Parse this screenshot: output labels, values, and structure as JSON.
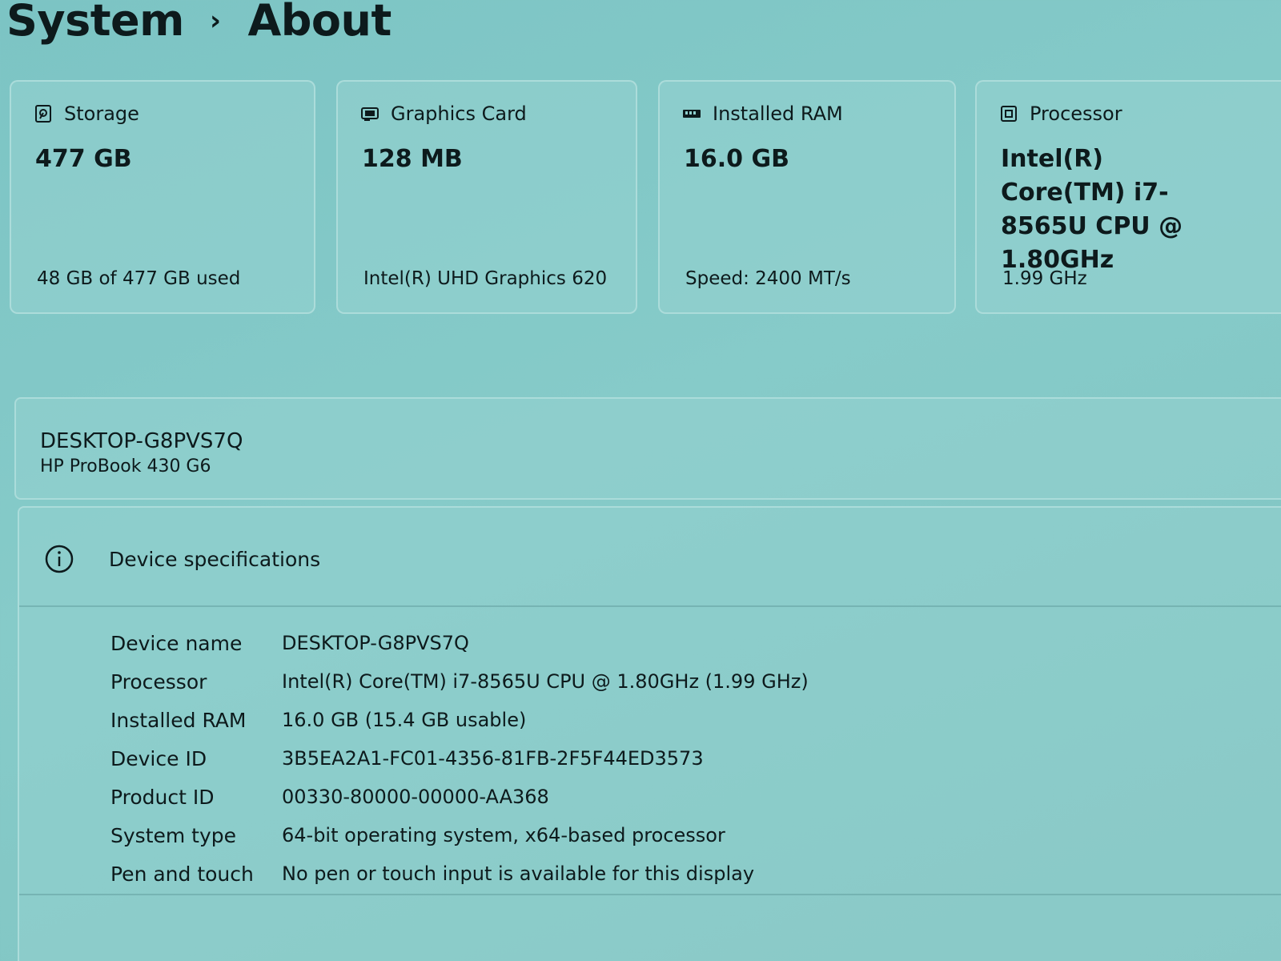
{
  "breadcrumb": {
    "parent": "System",
    "separator": "›",
    "current": "About"
  },
  "cards": {
    "storage": {
      "icon": "storage-icon",
      "label": "Storage",
      "value": "477 GB",
      "detail": "48 GB of 477 GB used"
    },
    "graphics": {
      "icon": "graphics-card-icon",
      "label": "Graphics Card",
      "value": "128 MB",
      "detail": "Intel(R) UHD Graphics 620"
    },
    "ram": {
      "icon": "ram-icon",
      "label": "Installed RAM",
      "value": "16.0 GB",
      "detail": "Speed: 2400 MT/s"
    },
    "processor": {
      "icon": "processor-icon",
      "label": "Processor",
      "value": "Intel(R) Core(TM) i7-8565U CPU @ 1.80GHz",
      "detail": "1.99 GHz"
    }
  },
  "device": {
    "name": "DESKTOP-G8PVS7Q",
    "model": "HP ProBook 430 G6"
  },
  "specs": {
    "icon": "info-icon",
    "title": "Device specifications",
    "rows": [
      {
        "label": "Device name",
        "value": "DESKTOP-G8PVS7Q"
      },
      {
        "label": "Processor",
        "value": "Intel(R) Core(TM) i7-8565U CPU @ 1.80GHz (1.99 GHz)"
      },
      {
        "label": "Installed RAM",
        "value": "16.0 GB (15.4 GB usable)"
      },
      {
        "label": "Device ID",
        "value": "3B5EA2A1-FC01-4356-81FB-2F5F44ED3573"
      },
      {
        "label": "Product ID",
        "value": "00330-80000-00000-AA368"
      },
      {
        "label": "System type",
        "value": "64-bit operating system, x64-based processor"
      },
      {
        "label": "Pen and touch",
        "value": "No pen or touch input is available for this display"
      }
    ]
  }
}
